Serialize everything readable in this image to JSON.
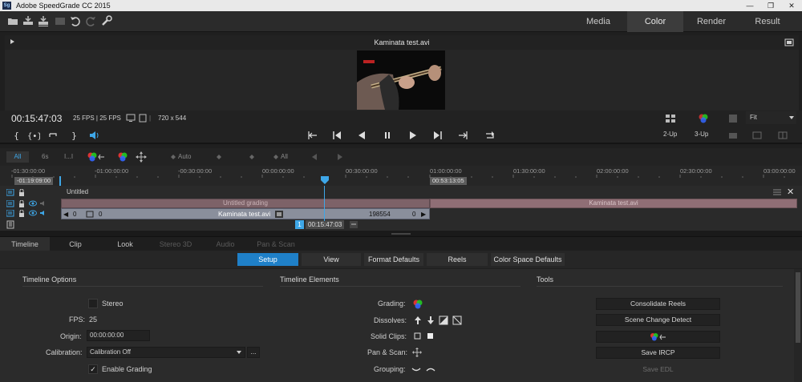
{
  "app": {
    "title": "Adobe SpeedGrade CC 2015",
    "icon_text": "Sg"
  },
  "window_controls": {
    "minimize": "—",
    "restore": "❐",
    "close": "✕"
  },
  "main_tabs": [
    "Media",
    "Color",
    "Render",
    "Result"
  ],
  "main_tab_active": "Color",
  "viewer": {
    "clip_name": "Kaminata test.avi",
    "timecode": "00:15:47:03",
    "fps_info": "25 FPS  |  25 FPS",
    "resolution": "720 x 544",
    "zoom": "Fit",
    "layout_2up": "2-Up",
    "layout_3up": "3-Up"
  },
  "filter_bar": {
    "all": "All",
    "six_s": "6s",
    "i_dots": "I...I",
    "auto": "Auto",
    "all2": "All"
  },
  "ruler": {
    "labels": [
      "-01:30:00:00",
      "-01:00:00:00",
      "-00:30:00:00",
      "00:00:00:00",
      "00:30:00:00",
      "01:00:00:00",
      "01:30:00:00",
      "02:00:00:00",
      "02:30:00:00",
      "03:00:00:00"
    ],
    "in_tc": "-01:19:09:00",
    "out_tc": "00:53:13:05"
  },
  "tracks": {
    "sequence_name": "Untitled",
    "grading_label": "Untitled grading",
    "grading_right_label": "Kaminata test.avi",
    "clip_label": "Kaminata test.avi",
    "clip_left_num": "0",
    "clip_left_num2": "0",
    "clip_right_num": "198554",
    "clip_right_num2": "0",
    "marker_num": "1",
    "playhead_tc": "00:15:47:03"
  },
  "lower_tabs": [
    {
      "label": "Timeline",
      "enabled": true
    },
    {
      "label": "Clip",
      "enabled": true
    },
    {
      "label": "Look",
      "enabled": true
    },
    {
      "label": "Stereo 3D",
      "enabled": false
    },
    {
      "label": "Audio",
      "enabled": false
    },
    {
      "label": "Pan & Scan",
      "enabled": false
    }
  ],
  "sub_tabs": [
    "Setup",
    "View",
    "Format Defaults",
    "Reels",
    "Color Space Defaults"
  ],
  "sub_tab_active": "Setup",
  "timeline_options": {
    "heading": "Timeline Options",
    "stereo_label": "Stereo",
    "fps_label": "FPS:",
    "fps_value": "25",
    "origin_label": "Origin:",
    "origin_value": "00:00:00:00",
    "calibration_label": "Calibration:",
    "calibration_value": "Calibration Off",
    "calibration_more": "...",
    "enable_grading_label": "Enable Grading",
    "enable_grading_checked": true
  },
  "timeline_elements": {
    "heading": "Timeline Elements",
    "grading_label": "Grading:",
    "dissolves_label": "Dissolves:",
    "solid_clips_label": "Solid Clips:",
    "pan_scan_label": "Pan & Scan:",
    "grouping_label": "Grouping:"
  },
  "tools": {
    "heading": "Tools",
    "consolidate_reels": "Consolidate Reels",
    "scene_change_detect": "Scene Change Detect",
    "save_ircp": "Save IRCP",
    "save_edl": "Save EDL"
  },
  "colors": {
    "accent_blue": "#1f80c8",
    "grading_track": "#8a6a72",
    "clip_track": "#7a7e8a",
    "playhead": "#3ea7e8"
  }
}
